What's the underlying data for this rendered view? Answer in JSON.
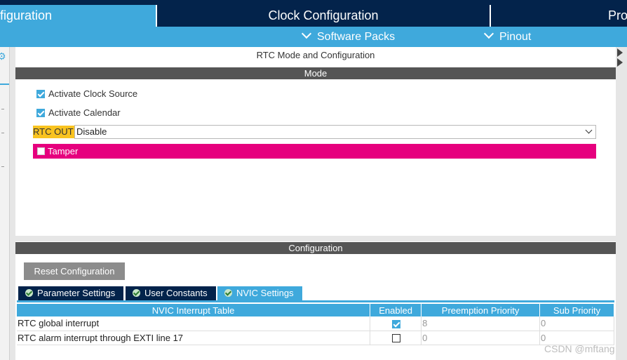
{
  "top_tabs": [
    {
      "label": "figuration"
    },
    {
      "label": "Clock Configuration"
    },
    {
      "label": "Pro"
    }
  ],
  "sub_bar": {
    "software_packs": "Software Packs",
    "pinout": "Pinout"
  },
  "panel": {
    "title": "RTC Mode and Configuration",
    "mode_header": "Mode",
    "activate_clock_source": "Activate Clock Source",
    "activate_calendar": "Activate Calendar",
    "rtc_out_label": "RTC OUT",
    "rtc_out_value": "Disable",
    "tamper": "Tamper"
  },
  "config": {
    "header": "Configuration",
    "reset_button": "Reset Configuration",
    "tabs": [
      {
        "label": "Parameter Settings"
      },
      {
        "label": "User Constants"
      },
      {
        "label": "NVIC Settings"
      }
    ],
    "table": {
      "headers": [
        "NVIC Interrupt Table",
        "Enabled",
        "Preemption Priority",
        "Sub Priority"
      ],
      "rows": [
        {
          "name": "RTC global interrupt",
          "enabled": true,
          "preemption": "8",
          "sub": "0"
        },
        {
          "name": "RTC alarm interrupt through EXTI line 17",
          "enabled": false,
          "preemption": "0",
          "sub": "0"
        }
      ]
    }
  },
  "watermark": "CSDN @mftang",
  "colors": {
    "navy": "#03234b",
    "accent_blue": "#3fa9dc",
    "header_gray": "#555555",
    "rtc_out_highlight": "#f9c31f",
    "tamper_highlight": "#e6007e"
  },
  "icons": {
    "gear": "gear-icon",
    "chevron": "chevron-down-icon",
    "tab_check": "check-circle-icon"
  }
}
